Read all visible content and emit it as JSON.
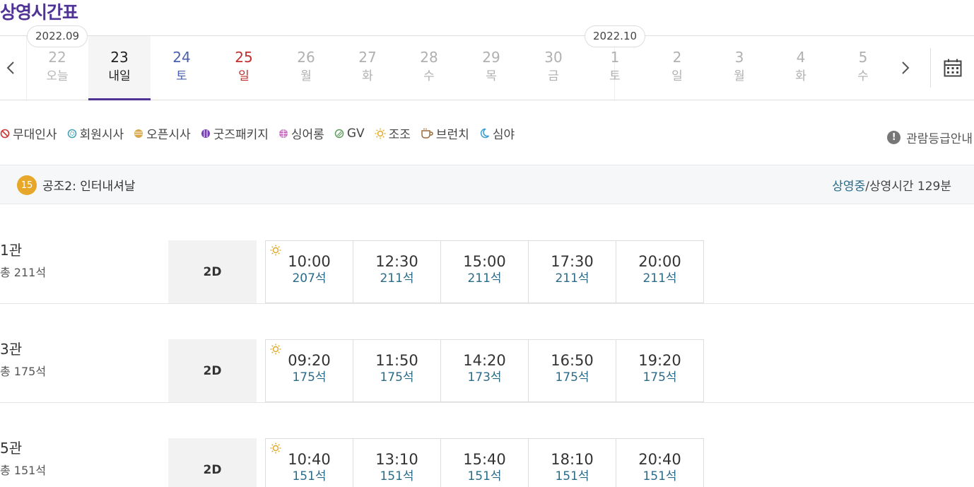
{
  "page_title": "상영시간표",
  "months": [
    "2022.09",
    "2022.10"
  ],
  "days": [
    {
      "num": "22",
      "label": "오늘"
    },
    {
      "num": "23",
      "label": "내일"
    },
    {
      "num": "24",
      "label": "토"
    },
    {
      "num": "25",
      "label": "일"
    },
    {
      "num": "26",
      "label": "월"
    },
    {
      "num": "27",
      "label": "화"
    },
    {
      "num": "28",
      "label": "수"
    },
    {
      "num": "29",
      "label": "목"
    },
    {
      "num": "30",
      "label": "금"
    },
    {
      "num": "1",
      "label": "토"
    },
    {
      "num": "2",
      "label": "일"
    },
    {
      "num": "3",
      "label": "월"
    },
    {
      "num": "4",
      "label": "화"
    },
    {
      "num": "5",
      "label": "수"
    }
  ],
  "legend": [
    "무대인사",
    "회원시사",
    "오픈시사",
    "굿즈패키지",
    "싱어롱",
    "GV",
    "조조",
    "브런치",
    "심야"
  ],
  "rating_guide": "관람등급안내",
  "movie": {
    "age": "15",
    "title": "공조2: 인터내셔날",
    "status_on": "상영중",
    "status_rest": "/상영시간 129분"
  },
  "theaters": [
    {
      "name": "1관",
      "seats": "총 211석",
      "format": "2D",
      "slots": [
        {
          "time": "10:00",
          "seats": "207석"
        },
        {
          "time": "12:30",
          "seats": "211석"
        },
        {
          "time": "15:00",
          "seats": "211석"
        },
        {
          "time": "17:30",
          "seats": "211석"
        },
        {
          "time": "20:00",
          "seats": "211석"
        }
      ]
    },
    {
      "name": "3관",
      "seats": "총 175석",
      "format": "2D",
      "slots": [
        {
          "time": "09:20",
          "seats": "175석"
        },
        {
          "time": "11:50",
          "seats": "175석"
        },
        {
          "time": "14:20",
          "seats": "173석"
        },
        {
          "time": "16:50",
          "seats": "175석"
        },
        {
          "time": "19:20",
          "seats": "175석"
        }
      ]
    },
    {
      "name": "5관",
      "seats": "총 151석",
      "format": "2D",
      "slots": [
        {
          "time": "10:40",
          "seats": "151석"
        },
        {
          "time": "13:10",
          "seats": "151석"
        },
        {
          "time": "15:40",
          "seats": "151석"
        },
        {
          "time": "18:10",
          "seats": "151석"
        },
        {
          "time": "20:40",
          "seats": "151석"
        }
      ]
    }
  ]
}
